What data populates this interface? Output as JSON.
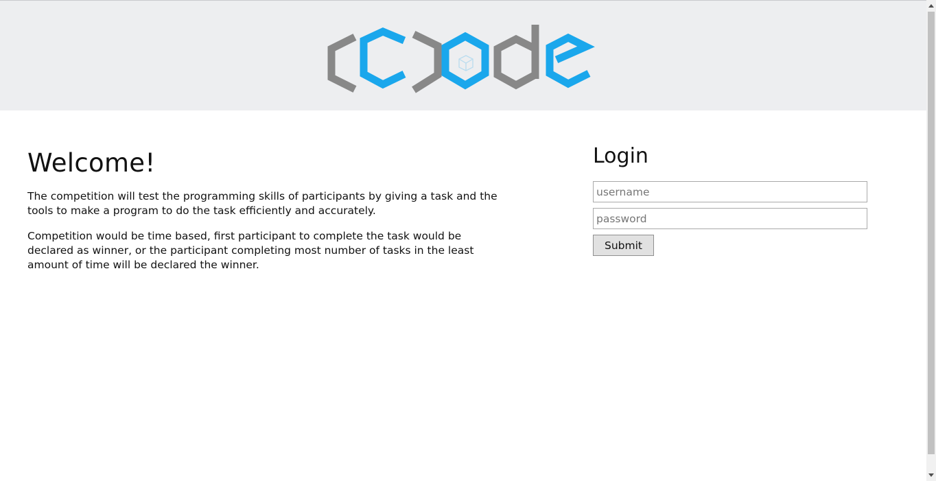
{
  "header": {
    "logo_text": "(c)ode",
    "logo_icon": "hexagon-cube-logo",
    "colors": {
      "gray": "#888888",
      "blue": "#1aa7ec",
      "background": "#edeef0"
    }
  },
  "welcome": {
    "title": "Welcome!",
    "paragraphs": [
      "The competition will test the programming skills of participants by giving a task and the tools to make a program to do the task efficiently and accurately.",
      "Competition would be time based, first participant to complete the task would be declared as winner, or the participant completing most number of tasks in the least amount of time will be declared the winner."
    ]
  },
  "login": {
    "title": "Login",
    "username": {
      "value": "",
      "placeholder": "username"
    },
    "password": {
      "value": "",
      "placeholder": "password"
    },
    "submit_label": "Submit"
  },
  "scrollbar": {
    "up_icon": "scroll-up-arrow-icon",
    "down_icon": "scroll-down-arrow-icon"
  }
}
